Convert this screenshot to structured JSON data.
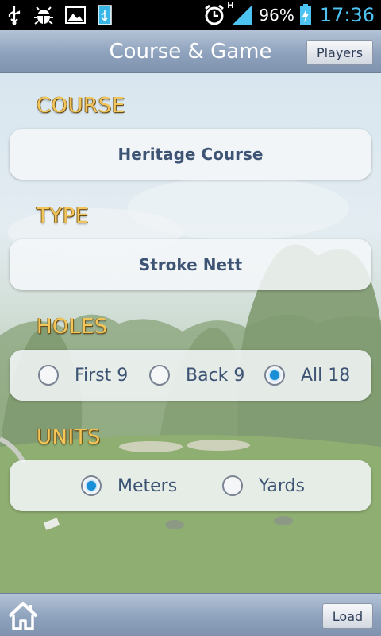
{
  "status_bar": {
    "icons": [
      "usb-icon",
      "android-debug-icon",
      "image-icon",
      "sd-card-icon",
      "alarm-icon",
      "signal-h-icon",
      "battery-charging-icon"
    ],
    "network": "H",
    "battery": "96%",
    "time": "17:36"
  },
  "header": {
    "title": "Course & Game",
    "players_label": "Players"
  },
  "course": {
    "label": "COURSE",
    "value": "Heritage Course"
  },
  "type": {
    "label": "TYPE",
    "value": "Stroke Nett"
  },
  "holes": {
    "label": "HOLES",
    "options": [
      {
        "label": "First 9",
        "selected": false
      },
      {
        "label": "Back 9",
        "selected": false
      },
      {
        "label": "All 18",
        "selected": true
      }
    ]
  },
  "units": {
    "label": "UNITS",
    "options": [
      {
        "label": "Meters",
        "selected": true
      },
      {
        "label": "Yards",
        "selected": false
      }
    ]
  },
  "footer": {
    "home_icon": "home-icon",
    "load_label": "Load"
  },
  "colors": {
    "accent": "#1a8fd6",
    "section_label": "#f1c55a",
    "panel_text": "#3e5474",
    "time": "#4cc3f0"
  }
}
